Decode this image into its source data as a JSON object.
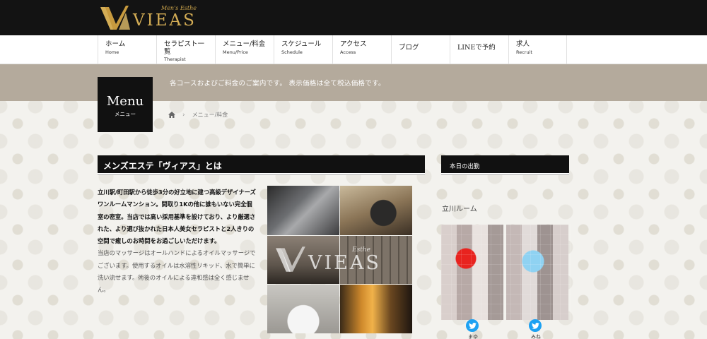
{
  "header": {
    "logo_text": "VIEAS",
    "logo_sub": "Men's Esthe"
  },
  "nav": [
    {
      "ja": "ホーム",
      "en": "Home"
    },
    {
      "ja": "セラピスト一覧",
      "en": "Therapist"
    },
    {
      "ja": "メニュー/料金",
      "en": "Menu/Price"
    },
    {
      "ja": "スケジュール",
      "en": "Schedule"
    },
    {
      "ja": "アクセス",
      "en": "Access"
    },
    {
      "ja": "ブログ",
      "en": ""
    },
    {
      "ja": "LINEで予約",
      "en": ""
    },
    {
      "ja": "求人",
      "en": "Recruit"
    }
  ],
  "banner": {
    "text": "各コースおよびご料金のご案内です。 表示価格は全て税込価格です。"
  },
  "page": {
    "title": "Menu",
    "subtitle": "メニュー",
    "breadcrumb_current": "メニュー/料金"
  },
  "main": {
    "heading": "メンズエステ「ヴィアス」とは",
    "paragraph_bold": "立川駅/町田駅から徒歩3分の好立地に建つ高級デザイナーズワンルームマンション。間取り1Kの他に誰もいない完全個室の密室。当店では高い採用基準を設けており、より厳選された、より選び抜かれた日本人美女セラピストと2人きりの空間で癒しのお時間をお過ごしいただけます。",
    "paragraph_light": "当店のマッサージはオールハンドによるオイルマッサージでございます。使用するオイルは水溶性リキッド、水で簡単に洗い流せます。術後のオイルによる違和感は全く感じません。",
    "collage_logo_text": "VIEAS",
    "collage_logo_sub": "Esthe"
  },
  "sidebar": {
    "heading": "本日の出勤",
    "room": "立川ルーム",
    "therapists": [
      {
        "name": "まゆ"
      },
      {
        "name": "みね"
      }
    ]
  },
  "colors": {
    "gold": "#d4ad55",
    "black": "#111111",
    "banner": "#b4aa9c",
    "twitter": "#1da1f2"
  }
}
